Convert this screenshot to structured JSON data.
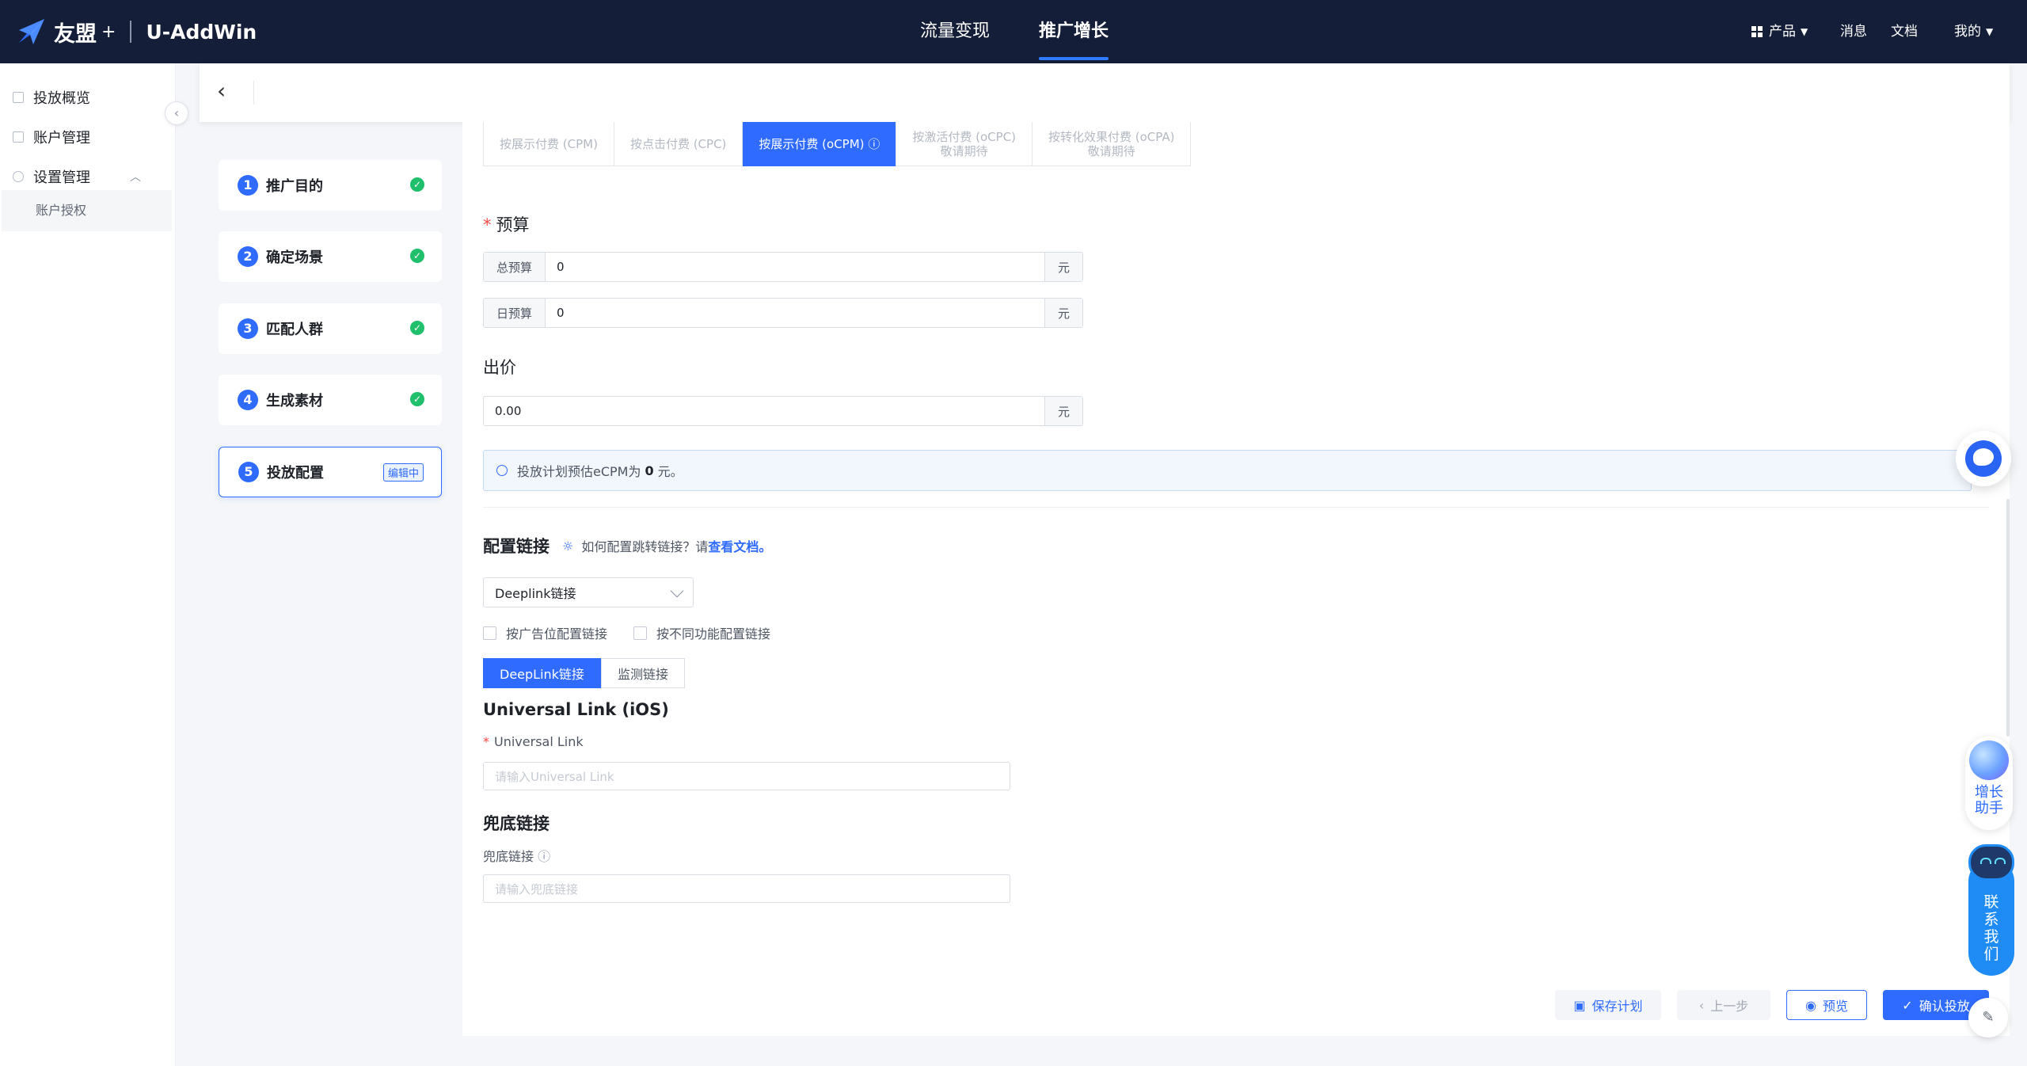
{
  "header": {
    "brand": "友盟",
    "brand_plus": "+",
    "app_name": "U-AddWin",
    "nav": [
      "流量变现",
      "推广增长"
    ],
    "right": {
      "product": "产品",
      "messages": "消息",
      "docs": "文档",
      "mine": "我的"
    }
  },
  "sidebar": {
    "items": [
      "投放概览",
      "账户管理",
      "设置管理"
    ],
    "sub_items": [
      "账户授权"
    ]
  },
  "steps": [
    {
      "num": "1",
      "label": "推广目的",
      "done": true
    },
    {
      "num": "2",
      "label": "确定场景",
      "done": true
    },
    {
      "num": "3",
      "label": "匹配人群",
      "done": true
    },
    {
      "num": "4",
      "label": "生成素材",
      "done": true
    },
    {
      "num": "5",
      "label": "投放配置",
      "badge": "编辑中"
    }
  ],
  "billing_tabs": [
    {
      "label": "按展示付费 (CPM)"
    },
    {
      "label": "按点击付费 (CPC)"
    },
    {
      "label": "按展示付费 (oCPM)",
      "icon": "ⓘ"
    },
    {
      "label": "按激活付费 (oCPC)",
      "sub": "敬请期待"
    },
    {
      "label": "按转化效果付费 (oCPA)",
      "sub": "敬请期待"
    }
  ],
  "budget": {
    "title": "预算",
    "total": {
      "prefix": "总预算",
      "value": "0",
      "suffix": "元"
    },
    "daily": {
      "prefix": "日预算",
      "value": "0",
      "suffix": "元"
    }
  },
  "bid": {
    "title": "出价",
    "value": "0.00",
    "suffix": "元"
  },
  "notice": {
    "text_before": "投放计划预估eCPM为",
    "value": "0",
    "text_after": "元。"
  },
  "link_config": {
    "title": "配置链接",
    "hint": "如何配置跳转链接？请",
    "hint_link": "查看文档。",
    "select_value": "Deeplink链接",
    "checkbox_1": "按广告位配置链接",
    "checkbox_2": "按不同功能配置链接",
    "seg_1": "DeepLink链接",
    "seg_2": "监测链接",
    "ul_title": "Universal Link (iOS)",
    "ul_label": "Universal Link",
    "ul_placeholder": "请输入Universal Link",
    "fallback_title": "兜底链接",
    "fallback_label": "兜底链接",
    "fallback_placeholder": "请输入兜底链接"
  },
  "footer": {
    "save": "保存计划",
    "prev": "上一步",
    "preview": "预览",
    "confirm": "确认投放"
  },
  "floating": {
    "helper": "增长助手",
    "contact": "联系我们"
  },
  "colors": {
    "primary": "#2f6bff",
    "topbar": "#151e38",
    "success": "#1fbf6b"
  }
}
